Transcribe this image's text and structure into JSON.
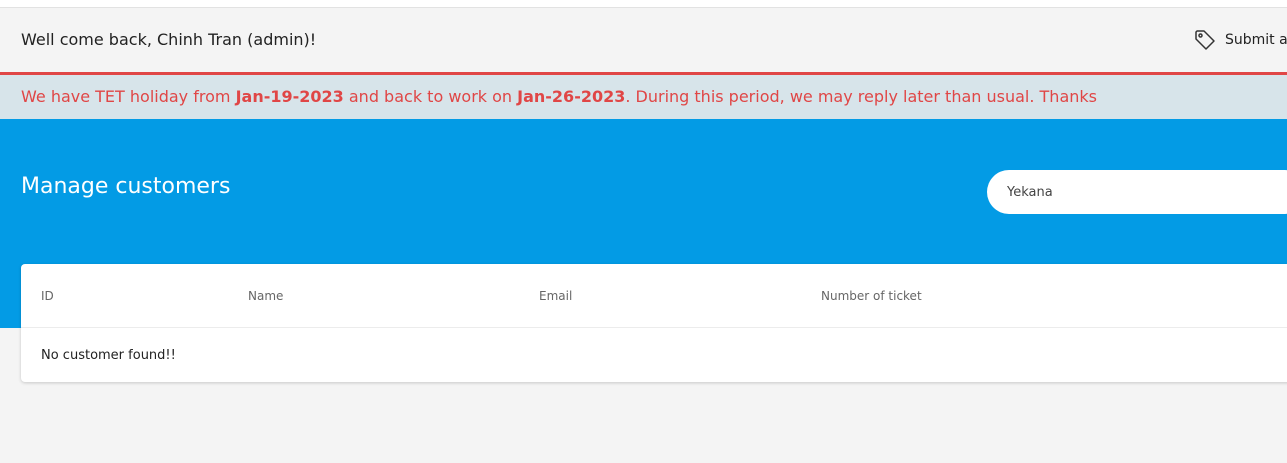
{
  "header": {
    "welcome": "Well come back, Chinh Tran (admin)!",
    "submit_label": "Submit a",
    "submit_icon": "tag-icon"
  },
  "notice": {
    "part1": "We have TET holiday from ",
    "start_date": "Jan-19-2023",
    "part2": " and back to work on ",
    "end_date": "Jan-26-2023",
    "part3": ". During this period, we may reply later than usual. Thanks",
    "color": "#e04646"
  },
  "banner": {
    "title": "Manage customers",
    "color": "#039be5"
  },
  "search": {
    "value": "Yekana"
  },
  "table": {
    "columns": [
      "ID",
      "Name",
      "Email",
      "Number of ticket"
    ],
    "empty_message": "No customer found!!"
  }
}
